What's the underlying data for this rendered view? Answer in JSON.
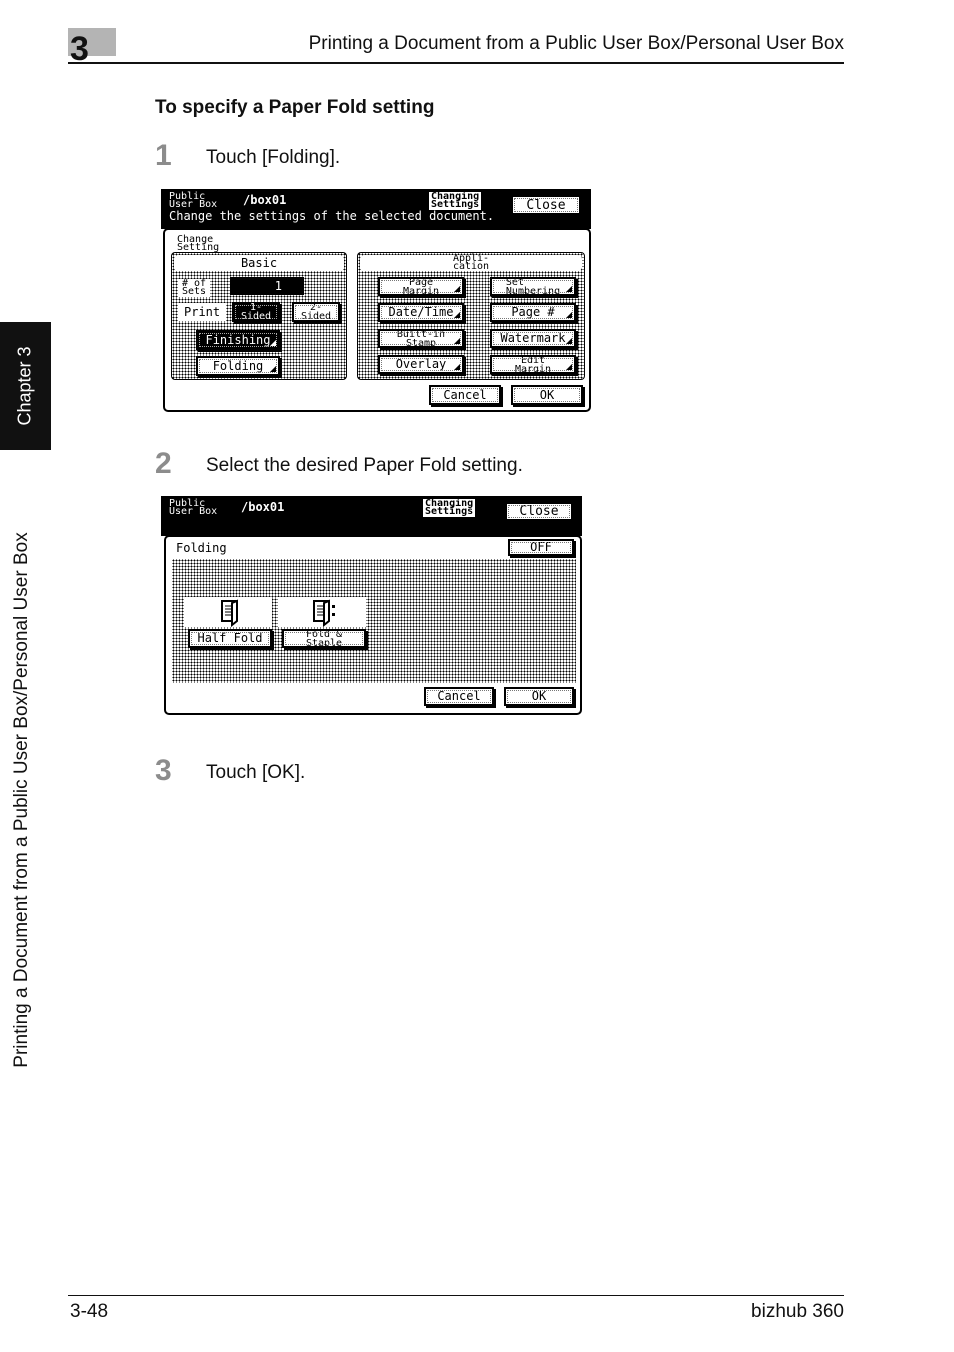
{
  "header": {
    "chapter_number": "3",
    "title": "Printing a Document from a Public User Box/Personal User Box"
  },
  "side": {
    "chapter_tab": "Chapter 3",
    "section_title": "Printing a Document from a Public User Box/Personal User Box"
  },
  "section_title": "To specify a Paper Fold setting",
  "steps": [
    {
      "number": "1",
      "text": "Touch [Folding]."
    },
    {
      "number": "2",
      "text": "Select the desired Paper Fold setting."
    },
    {
      "number": "3",
      "text": "Touch [OK]."
    }
  ],
  "screen1": {
    "box_type_line1": "Public",
    "box_type_line2": "User Box",
    "box_path": "/box01",
    "mode_line1": "Changing",
    "mode_line2": "Settings",
    "close": "Close",
    "message": "Change the settings of the selected document.",
    "panel_title_line1": "Change",
    "panel_title_line2": "Setting",
    "basic": {
      "header": "Basic",
      "sets_label_line1": "# of",
      "sets_label_line2": "Sets",
      "sets_value": "1",
      "print_label": "Print",
      "one_sided_line1": "1-",
      "one_sided_line2": "Sided",
      "two_sided_line1": "2-",
      "two_sided_line2": "Sided",
      "finishing": "Finishing",
      "folding": "Folding"
    },
    "application": {
      "header_line1": "Appli-",
      "header_line2": "cation",
      "buttons": [
        {
          "line1": "Page",
          "line2": "Margin"
        },
        {
          "line1": "Set",
          "line2": "Numbering"
        },
        {
          "line1": "Date/Time",
          "line2": ""
        },
        {
          "line1": "Page #",
          "line2": ""
        },
        {
          "line1": "Built-in",
          "line2": "Stamp"
        },
        {
          "line1": "Watermark",
          "line2": ""
        },
        {
          "line1": "Overlay",
          "line2": ""
        },
        {
          "line1": "Edit",
          "line2": "Margin"
        }
      ]
    },
    "cancel": "Cancel",
    "ok": "OK"
  },
  "screen2": {
    "box_type_line1": "Public",
    "box_type_line2": "User Box",
    "box_path": "/box01",
    "mode_line1": "Changing",
    "mode_line2": "Settings",
    "close": "Close",
    "panel_title": "Folding",
    "off": "OFF",
    "options": [
      {
        "line1": "Half Fold",
        "line2": "",
        "icon": "half-fold-icon"
      },
      {
        "line1": "Fold &",
        "line2": "Staple",
        "icon": "fold-staple-icon"
      }
    ],
    "cancel": "Cancel",
    "ok": "OK"
  },
  "footer": {
    "page": "3-48",
    "model": "bizhub 360"
  }
}
